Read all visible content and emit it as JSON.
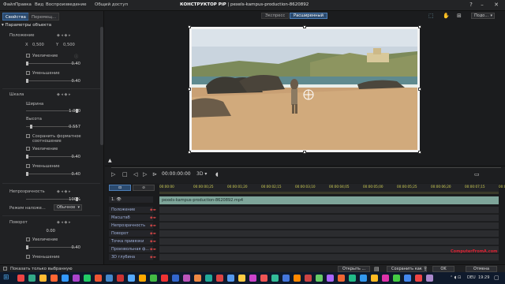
{
  "menu": [
    "Файл",
    "Правка",
    "Вид",
    "Воспроизведение",
    "Общий доступ"
  ],
  "window_title_bold": "КОНСТРУКТОР PiP",
  "window_title_rest": "pexels-kampus-production-8620892",
  "tabs": {
    "properties": "Свойства",
    "motion": "Перемещ..."
  },
  "section_title": "Параметры объекта",
  "position": {
    "label": "Положение",
    "x_label": "X",
    "x_value": "0,500",
    "y_label": "Y",
    "y_value": "0,500"
  },
  "zoom_labels": [
    "Увеличение",
    "Уменьшение"
  ],
  "zoom_values": [
    "0.40",
    "0.40"
  ],
  "scale": {
    "label": "Шкала",
    "width_label": "Ширина",
    "width_value": "1.000",
    "height_label": "Высота",
    "height_value": "0.557",
    "height_level": 0.557
  },
  "keep_aspect": "Сохранить форматное соотношение",
  "zoom2_labels": [
    "Увеличение",
    "Уменьшение"
  ],
  "zoom2_values": [
    "0.40",
    "0.40"
  ],
  "opacity": {
    "label": "Непрозрачность",
    "value": "100%"
  },
  "blend": {
    "label": "Режим наложе...",
    "value": "Обычное"
  },
  "rotation": {
    "label": "Поворот",
    "value": "0.00"
  },
  "rotation_zoom": [
    "Увеличение",
    "Уменьшение"
  ],
  "rotation_zoom_value": "0.40",
  "view_modes": {
    "express": "Экспресс",
    "advanced": "Расширенный"
  },
  "preview_dropdown": "Подо...",
  "timecode": "00:00:00:00",
  "mode_3d": "3D",
  "ruler_ticks": [
    "00:00:00",
    "00:00:00;25",
    "00:00:01;20",
    "00:00:02;15",
    "00:00:03;10",
    "00:00:04;05",
    "00:00:05;00",
    "00:00:05;25",
    "00:00:06;20",
    "00:00:07;15",
    "00:0"
  ],
  "track_row1": "1.",
  "clip_name": "pexels-kampus-production-8620892.mp4",
  "tracks": [
    "Положение",
    "Масштаб",
    "Непрозрачность",
    "Поворот",
    "Точка привязки",
    "Произвольная ф...",
    "3D глубина"
  ],
  "bottom": {
    "show_selected": "Показать только выбранную",
    "open": "Открыть ...",
    "save_as": "Сохранить как",
    "ok": "OK",
    "cancel": "Отмена"
  },
  "watermark": "ComputerFromA.com",
  "tray": {
    "lang": "DEU",
    "time": "19:29"
  }
}
